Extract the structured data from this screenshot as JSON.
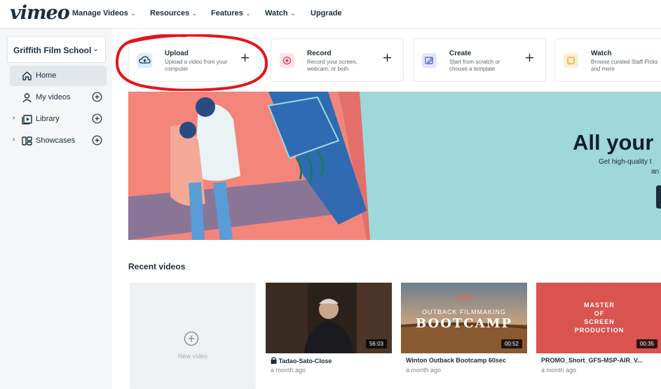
{
  "brand": {
    "logo": "vimeo"
  },
  "topnav": {
    "items": [
      {
        "label": "Manage Videos",
        "chevron": "⌄"
      },
      {
        "label": "Resources",
        "chevron": "⌄"
      },
      {
        "label": "Features",
        "chevron": "⌄"
      },
      {
        "label": "Watch",
        "chevron": "⌄"
      },
      {
        "label": "Upgrade"
      }
    ]
  },
  "sidebar": {
    "team": "Griffith Film School",
    "items": [
      {
        "label": "Home",
        "icon": "home-icon",
        "active": true
      },
      {
        "label": "My videos",
        "icon": "user-icon",
        "has_add": true
      },
      {
        "label": "Library",
        "icon": "library-icon",
        "has_add": true,
        "expandable": true
      },
      {
        "label": "Showcases",
        "icon": "showcases-icon",
        "has_add": true,
        "expandable": true
      }
    ]
  },
  "actions": [
    {
      "title": "Upload",
      "desc": "Upload a video from your computer",
      "icon": "cloud-upload-icon",
      "color": "#d6eefa"
    },
    {
      "title": "Record",
      "desc": "Record your screen, webcam, or both",
      "icon": "record-icon",
      "color": "#fde3e6"
    },
    {
      "title": "Create",
      "desc": "Start from scratch or choose a template",
      "icon": "create-icon",
      "color": "#e2e5fb"
    },
    {
      "title": "Watch",
      "desc": "Browse curated Staff Picks and more",
      "icon": "watch-icon",
      "color": "#fdeed0"
    }
  ],
  "banner": {
    "title": "All your",
    "subtitle": "Get high-quality t",
    "subtitle2": "an"
  },
  "recent": {
    "title": "Recent videos",
    "new_video_label": "New video",
    "videos": [
      {
        "title": "Tadao-Sato-Close",
        "date": "a month ago",
        "duration": "56:03",
        "locked": true
      },
      {
        "title": "Winton Outback Bootcamp 60sec",
        "date": "a month ago",
        "duration": "00:52",
        "thumb_brand": "Griffith",
        "thumb_line1": "OUTBACK FILMMAKING",
        "thumb_line2": "BOOTCAMP"
      },
      {
        "title": "PROMO_Short_GFS-MSP-AIR_V...",
        "date": "a month ago",
        "duration": "00:35",
        "thumb_lines": [
          "MASTER",
          "OF",
          "SCREEN",
          "PRODUCTION"
        ]
      }
    ]
  },
  "colors": {
    "accent": "#1a2e3b",
    "annotation": "#e3161b",
    "banner": "#9fd8db"
  }
}
